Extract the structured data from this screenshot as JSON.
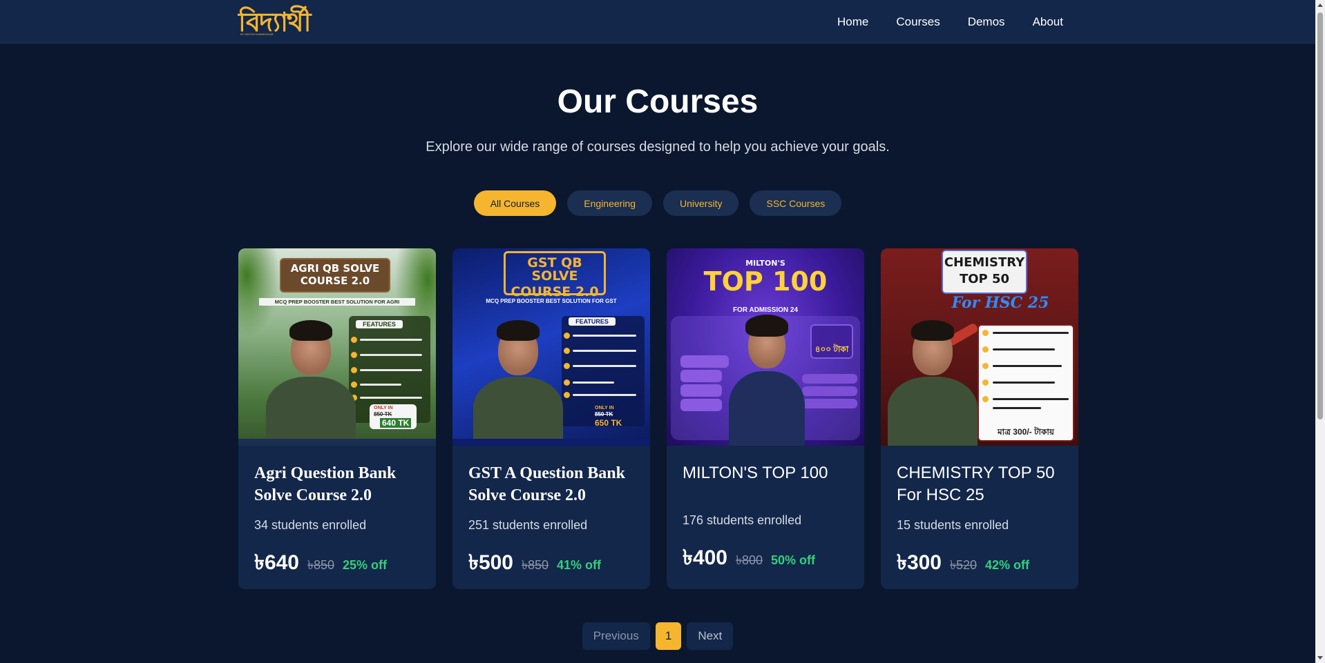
{
  "nav": {
    "logo_text": "বিদ্যার্থী",
    "logo_sub": "BY MILTON KHANDOKAR",
    "links": [
      "Home",
      "Courses",
      "Demos",
      "About"
    ]
  },
  "hero": {
    "title": "Our Courses",
    "subtitle": "Explore our wide range of courses designed to help you achieve your goals."
  },
  "filters": {
    "items": [
      "All Courses",
      "Engineering",
      "University",
      "SSC Courses"
    ],
    "active": "All Courses"
  },
  "courses": [
    {
      "title": "Agri Question Bank Solve Course 2.0",
      "enrolled": "34 students enrolled",
      "price": "৳640",
      "old_price": "৳850",
      "discount": "25% off",
      "poster": {
        "title_line1": "AGRI QB SOLVE",
        "title_line2": "COURSE 2.0",
        "tagline": "MCQ PREP BOOSTER BEST SOLUTION FOR AGRI",
        "features_label": "FEATURES",
        "badge_top": "ONLY IN",
        "badge_old": "850 TK",
        "badge_new": "640 TK"
      }
    },
    {
      "title": "GST A Question Bank Solve Course 2.0",
      "enrolled": "251 students enrolled",
      "price": "৳500",
      "old_price": "৳850",
      "discount": "41% off",
      "poster": {
        "title_line1": "GST QB SOLVE",
        "title_line2": "COURSE 2.0",
        "tagline": "MCQ PREP BOOSTER BEST SOLUTION FOR GST",
        "features_label": "FEATURES",
        "badge_top": "ONLY IN",
        "badge_old": "850 TK",
        "badge_new": "650 TK"
      }
    },
    {
      "title": "MILTON'S TOP 100",
      "enrolled": "176 students enrolled",
      "price": "৳400",
      "old_price": "৳800",
      "discount": "50% off",
      "poster": {
        "title_line1": "MILTON'S",
        "title_line2": "TOP 100",
        "tagline": "FOR ADMISSION 24",
        "price_tag": "৪০০ টাকা"
      }
    },
    {
      "title": "CHEMISTRY TOP 50 For HSC 25",
      "enrolled": "15 students enrolled",
      "price": "৳300",
      "old_price": "৳520",
      "discount": "42% off",
      "poster": {
        "title_line1": "CHEMISTRY",
        "title_line2": "TOP 50",
        "title_line3": "For HSC 25",
        "price_tag": "মাত্র 300/- টাকায়"
      }
    }
  ],
  "pagination": {
    "previous": "Previous",
    "current": "1",
    "next": "Next"
  }
}
